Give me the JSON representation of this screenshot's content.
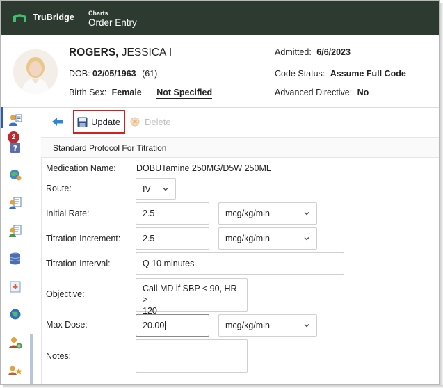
{
  "app": {
    "brand": "TruBridge",
    "crumb_small": "Charts",
    "crumb_title": "Order Entry"
  },
  "patient": {
    "last_name": "ROGERS,",
    "first_name": "JESSICA I",
    "dob_label": "DOB:",
    "dob_value": "02/05/1963",
    "age": "(61)",
    "sex_label": "Birth Sex:",
    "sex_value": "Female",
    "sex_secondary": "Not Specified",
    "admitted_label": "Admitted:",
    "admitted_value": "6/6/2023",
    "code_label": "Code Status:",
    "code_value": "Assume Full Code",
    "adv_label": "Advanced Directive:",
    "adv_value": "No"
  },
  "sidebar": {
    "badge_count": "2",
    "items": [
      {
        "icon": "orders-person-icon"
      },
      {
        "icon": "help-doc-icon"
      },
      {
        "icon": "globe-person-icon"
      },
      {
        "icon": "person-doc-icon"
      },
      {
        "icon": "person-doc-2-icon"
      },
      {
        "icon": "database-icon"
      },
      {
        "icon": "medical-doc-icon"
      },
      {
        "icon": "globe-icon"
      },
      {
        "icon": "user-add-icon"
      },
      {
        "icon": "favorites-icon"
      }
    ]
  },
  "toolbar": {
    "update_label": "Update",
    "delete_label": "Delete"
  },
  "form": {
    "section_title": "Standard Protocol For Titration",
    "medication_label": "Medication Name:",
    "medication_value": "DOBUTamine 250MG/D5W 250ML",
    "route_label": "Route:",
    "route_value": "IV",
    "initial_rate_label": "Initial Rate:",
    "initial_rate_value": "2.5",
    "initial_rate_unit": "mcg/kg/min",
    "titration_inc_label": "Titration Increment:",
    "titration_inc_value": "2.5",
    "titration_inc_unit": "mcg/kg/min",
    "titration_int_label": "Titration Interval:",
    "titration_int_value": "Q 10 minutes",
    "objective_label": "Objective:",
    "objective_value_line1": "Call MD if SBP < 90, HR >",
    "objective_value_line2": "120",
    "max_dose_label": "Max Dose:",
    "max_dose_value": "20.00",
    "max_dose_unit": "mcg/kg/min",
    "notes_label": "Notes:",
    "notes_value": ""
  },
  "colors": {
    "topbar": "#2d3a30",
    "accent_green": "#3fbf6a",
    "highlight_red": "#d32020",
    "badge_red": "#c0282d"
  }
}
